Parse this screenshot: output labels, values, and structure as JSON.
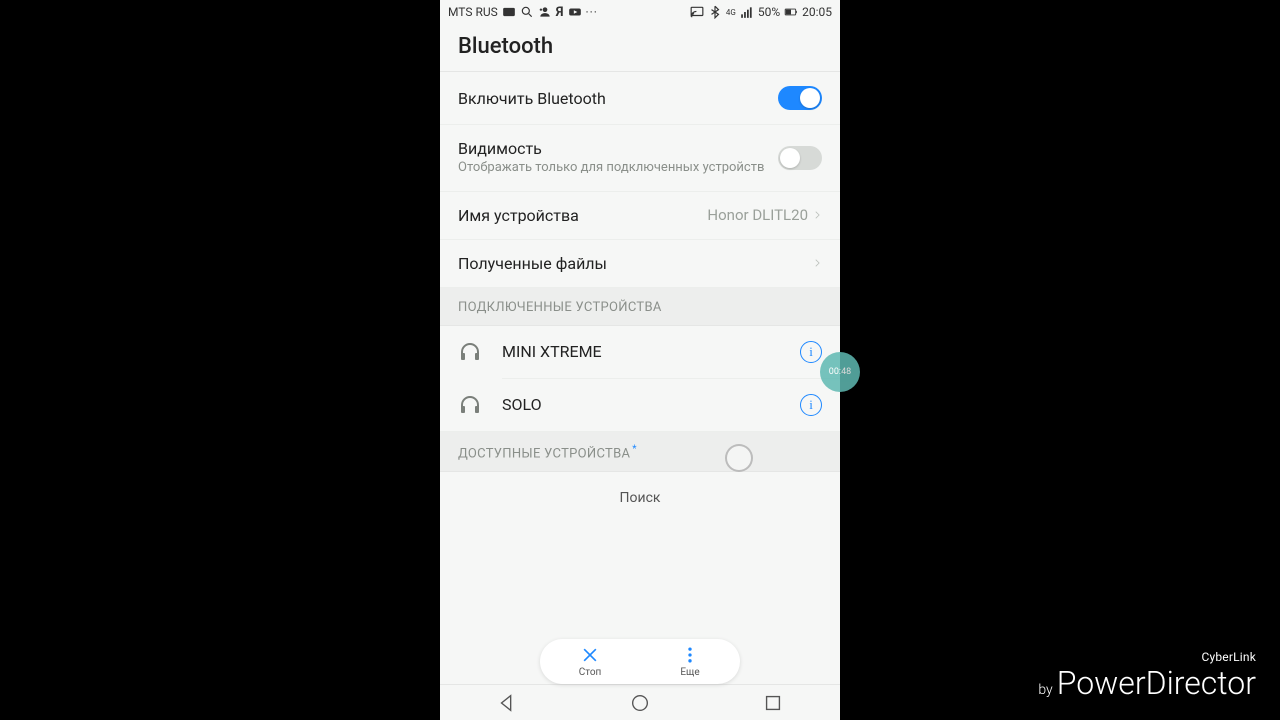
{
  "status": {
    "carrier": "MTS RUS",
    "battery_pct": "50%",
    "time": "20:05"
  },
  "header": {
    "title": "Bluetooth"
  },
  "rows": {
    "enable": {
      "label": "Включить Bluetooth"
    },
    "visibility": {
      "label": "Видимость",
      "sub": "Отображать только для подключенных устройств"
    },
    "devname": {
      "label": "Имя устройства",
      "value": "Honor DLITL20"
    },
    "received": {
      "label": "Полученные файлы"
    }
  },
  "sections": {
    "paired": "ПОДКЛЮЧЕННЫЕ УСТРОЙСТВА",
    "available": "ДОСТУПНЫЕ УСТРОЙСТВА"
  },
  "devices": {
    "paired": [
      {
        "name": "MINI XTREME"
      },
      {
        "name": "SOLO"
      }
    ]
  },
  "scanning_label": "Поиск",
  "actions": {
    "stop": "Стоп",
    "more": "Еще"
  },
  "record_time": "00:48",
  "watermark": {
    "top": "CyberLink",
    "by": "by",
    "main": "PowerDirector"
  }
}
